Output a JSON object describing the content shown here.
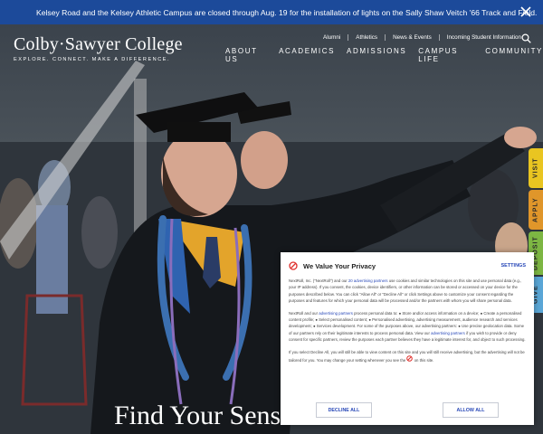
{
  "alert": {
    "message": "Kelsey Road and the Kelsey Athletic Campus are closed through Aug. 19 for the installation of lights on the Sally Shaw Veitch '66 Track and Field.",
    "close_icon": "close-icon"
  },
  "logo": {
    "name": "Colby·Sawyer College",
    "tagline": "EXPLORE. CONNECT. MAKE A DIFFERENCE."
  },
  "utility_nav": [
    "Alumni",
    "Athletics",
    "News & Events",
    "Incoming Student Information"
  ],
  "search_icon": "search-icon",
  "main_nav": [
    "ABOUT US",
    "ACADEMICS",
    "ADMISSIONS",
    "CAMPUS LIFE",
    "COMMUNITY"
  ],
  "side_tabs": [
    "VISIT",
    "APPLY",
    "DEPOSIT",
    "GIVE"
  ],
  "hero": {
    "headline": "Find Your Sense of Place"
  },
  "consent": {
    "title": "We Value Your Privacy",
    "settings_label": "SETTINGS",
    "logo_icon": "nextroll-logo-icon",
    "para1_pre": "NextRoll, Inc. (\"NextRoll\") and our ",
    "para1_link": "20 advertising partners",
    "para1_post": " use cookies and similar technologies on this site and use personal data (e.g., your IP address). If you consent, the cookies, device identifiers, or other information can be stored or accessed on your device for the purposes described below. You can click \"Allow All\" or \"Decline All\" or click Settings above to customize your consent regarding the purposes and features for which your personal data will be processed and/or the partners with whom you will share personal data.",
    "para2_pre": "NextRoll and our ",
    "para2_link1": "advertising partners",
    "para2_mid": " process personal data to: ● Store and/or access information on a device; ● Create a personalised content profile; ● Select personalised content; ● Personalised advertising, advertising measurement, audience research and services development; ● Services development. For some of the purposes above, our advertising partners: ● Use precise geolocation data. Some of our partners rely on their legitimate interests to process personal data. View our ",
    "para2_link2": "advertising partners",
    "para2_post": " if you wish to provide or deny consent for specific partners, review the purposes each partner believes they have a legitimate interest for, and object to such processing.",
    "para3_pre": "If you select Decline All, you will still be able to view content on this site and you will still receive advertising, but the advertising will not be tailored for you. You may change your setting whenever you see the ",
    "para3_post": " on this site.",
    "decline_label": "DECLINE ALL",
    "allow_label": "ALLOW ALL"
  },
  "colors": {
    "alert_bg": "#1c4a9a",
    "link_blue": "#2848b8",
    "visit": "#e9c521",
    "apply": "#e0962a",
    "deposit": "#7db643",
    "give": "#5aa6d6"
  }
}
